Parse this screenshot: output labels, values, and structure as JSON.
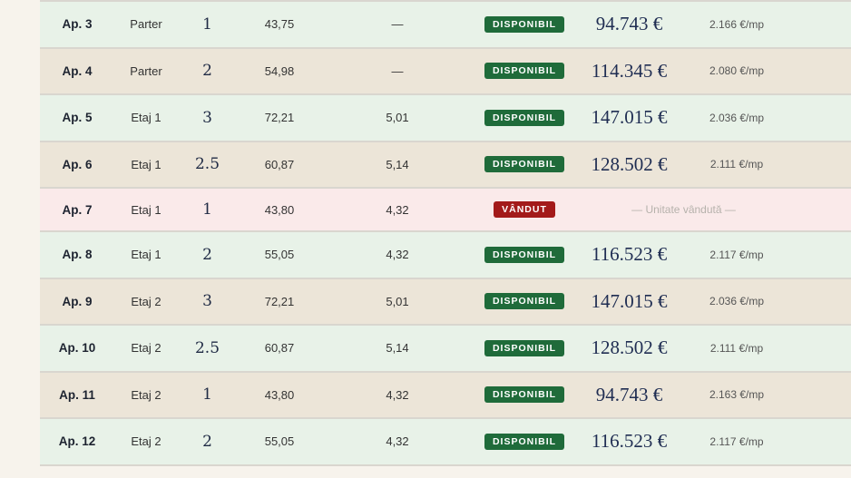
{
  "colors": {
    "available_badge": "#1f6b3a",
    "sold_badge": "#a31a1a",
    "row_green": "#e8f2e8",
    "row_beige": "#ece5d8",
    "row_sold": "#faeaea"
  },
  "rows": [
    {
      "ap": "Ap. 3",
      "floor": "Parter",
      "rooms": "1",
      "area": "43,75",
      "balcony": "—",
      "status": "DISPONIBIL",
      "price": "94.743 €",
      "unit_price": "2.166 €/mp"
    },
    {
      "ap": "Ap. 4",
      "floor": "Parter",
      "rooms": "2",
      "area": "54,98",
      "balcony": "—",
      "status": "DISPONIBIL",
      "price": "114.345 €",
      "unit_price": "2.080 €/mp"
    },
    {
      "ap": "Ap. 5",
      "floor": "Etaj 1",
      "rooms": "3",
      "area": "72,21",
      "balcony": "5,01",
      "status": "DISPONIBIL",
      "price": "147.015 €",
      "unit_price": "2.036 €/mp"
    },
    {
      "ap": "Ap. 6",
      "floor": "Etaj 1",
      "rooms": "2.5",
      "area": "60,87",
      "balcony": "5,14",
      "status": "DISPONIBIL",
      "price": "128.502 €",
      "unit_price": "2.111 €/mp"
    },
    {
      "ap": "Ap. 7",
      "floor": "Etaj 1",
      "rooms": "1",
      "area": "43,80",
      "balcony": "4,32",
      "status": "VÂNDUT",
      "sold_note": "— Unitate vândută —"
    },
    {
      "ap": "Ap. 8",
      "floor": "Etaj 1",
      "rooms": "2",
      "area": "55,05",
      "balcony": "4,32",
      "status": "DISPONIBIL",
      "price": "116.523 €",
      "unit_price": "2.117 €/mp"
    },
    {
      "ap": "Ap. 9",
      "floor": "Etaj 2",
      "rooms": "3",
      "area": "72,21",
      "balcony": "5,01",
      "status": "DISPONIBIL",
      "price": "147.015 €",
      "unit_price": "2.036 €/mp"
    },
    {
      "ap": "Ap. 10",
      "floor": "Etaj 2",
      "rooms": "2.5",
      "area": "60,87",
      "balcony": "5,14",
      "status": "DISPONIBIL",
      "price": "128.502 €",
      "unit_price": "2.111 €/mp"
    },
    {
      "ap": "Ap. 11",
      "floor": "Etaj 2",
      "rooms": "1",
      "area": "43,80",
      "balcony": "4,32",
      "status": "DISPONIBIL",
      "price": "94.743 €",
      "unit_price": "2.163 €/mp"
    },
    {
      "ap": "Ap. 12",
      "floor": "Etaj 2",
      "rooms": "2",
      "area": "55,05",
      "balcony": "4,32",
      "status": "DISPONIBIL",
      "price": "116.523 €",
      "unit_price": "2.117 €/mp"
    }
  ]
}
